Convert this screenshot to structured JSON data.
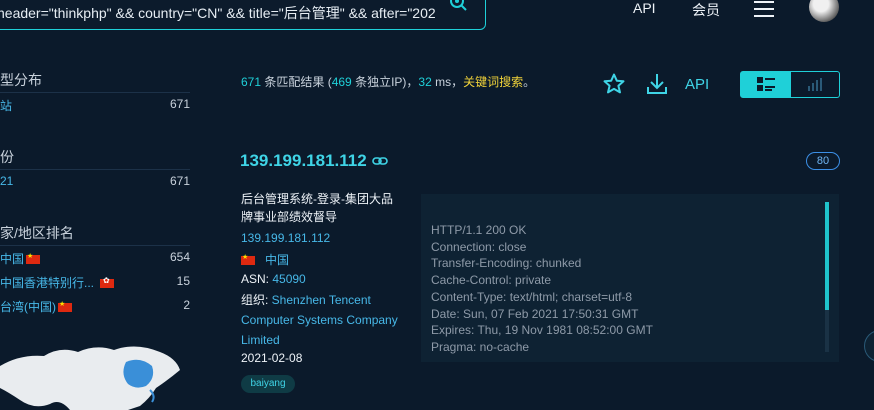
{
  "topbar": {
    "search_query": "header=\"thinkphp\" && country=\"CN\" && title=\"后台管理\" && after=\"202",
    "nav_api": "API",
    "nav_member": "会员"
  },
  "sidebar": {
    "type_title": "型分布",
    "type_items": [
      {
        "label": "站",
        "count": "671"
      }
    ],
    "year_title": "份",
    "year_items": [
      {
        "label": "21",
        "count": "671"
      }
    ],
    "country_title": "家/地区排名",
    "country_items": [
      {
        "label": "中国",
        "count": "654"
      },
      {
        "label": "中国香港特别行...",
        "count": "15"
      },
      {
        "label": "台湾(中国)",
        "count": "2"
      }
    ]
  },
  "summary": {
    "total": "671",
    "text_a": " 条匹配结果 (",
    "unique": "469",
    "text_b": " 条独立IP)，",
    "ms": "32",
    "text_c": " ms，",
    "keyword_search": "关键词搜索",
    "end": "。"
  },
  "toolbar": {
    "api_label": "API"
  },
  "result": {
    "ip": "139.199.181.112",
    "port": "80",
    "title": "后台管理系统-登录-集团大品牌事业部绩效督导",
    "ip_link": "139.199.181.112",
    "country": "中国",
    "asn_label": "ASN: ",
    "asn_value": "45090",
    "org_label": "组织: ",
    "org_value": "Shenzhen Tencent Computer Systems Company Limited",
    "date": "2021-02-08",
    "tag": "baiyang",
    "headers": [
      "HTTP/1.1 200 OK",
      "Connection: close",
      "Transfer-Encoding: chunked",
      "Cache-Control: private",
      "Content-Type: text/html; charset=utf-8",
      "Date: Sun, 07 Feb 2021 17:50:31 GMT",
      "Expires: Thu, 19 Nov 1981 08:52:00 GMT",
      "Pragma: no-cache"
    ]
  },
  "colors": {
    "accent": "#1fd0d8",
    "link": "#47b8e8",
    "keyword": "#f1d33a",
    "background": "#0b1a2b"
  }
}
